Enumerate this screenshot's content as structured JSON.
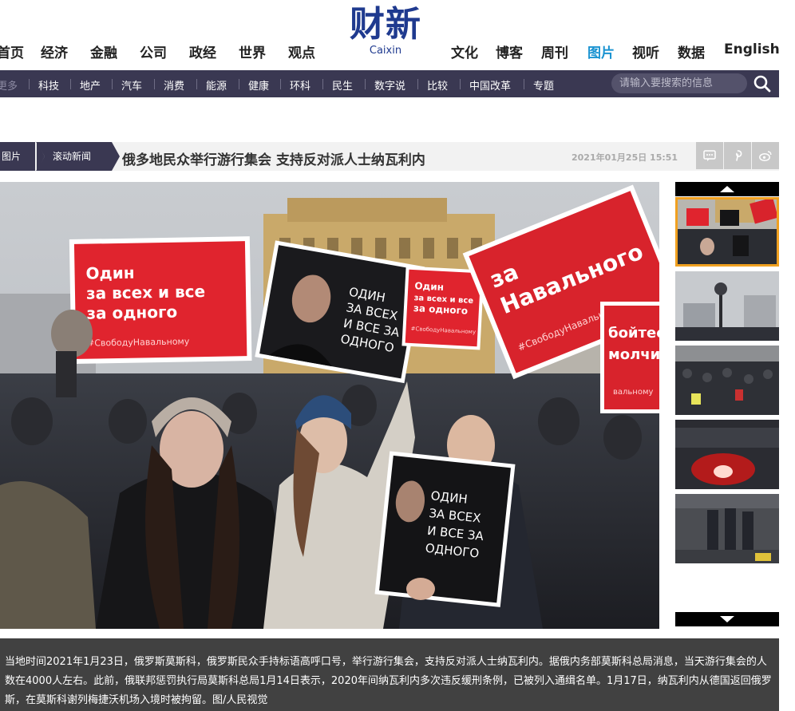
{
  "brand": {
    "name_cn": "财新",
    "name_en": "Caixin",
    "color": "#1f3a8f"
  },
  "top_nav": {
    "left": [
      "首页",
      "经济",
      "金融",
      "公司",
      "政经",
      "世界",
      "观点"
    ],
    "right": [
      "文化",
      "博客",
      "周刊",
      "图片",
      "视听",
      "数据",
      "English"
    ],
    "active": "图片",
    "active_color": "#1a93d1"
  },
  "sub_nav": {
    "items": [
      "更多",
      "科技",
      "地产",
      "汽车",
      "消费",
      "能源",
      "健康",
      "环科",
      "民生",
      "数字说",
      "比较",
      "中国改革",
      "专题"
    ],
    "search_placeholder": "请输入要搜索的信息",
    "bg_color": "#3a3852"
  },
  "breadcrumb": [
    "图片",
    "滚动新闻"
  ],
  "article": {
    "title": "俄多地民众举行游行集会 支持反对派人士纳瓦利内",
    "date": "2021年01月25日 15:51",
    "caption": "当地时间2021年1月23日，俄罗斯莫斯科，俄罗斯民众手持标语高呼口号，举行游行集会，支持反对派人士纳瓦利内。据俄内务部莫斯科总局消息，当天游行集会的人数在4000人左右。此前，俄联邦惩罚执行局莫斯科总局1月14日表示，2020年间纳瓦利内多次违反缓刑条例，已被列入通缉名单。1月17日，纳瓦利内从德国返回俄罗斯，在莫斯科谢列梅捷沃机场入境时被拘留。图/人民视觉"
  },
  "photo_signs": {
    "sign1_line1": "Один",
    "sign1_line2": "за всех и все",
    "sign1_line3": "за одного",
    "sign1_tag": "#СвободуНавальному",
    "sign2": [
      "ОДИН",
      "ЗА ВСЕХ",
      "И ВСЕ ЗА",
      "ОДНОГО"
    ],
    "sign3_line1": "Один",
    "sign3_line2": "за всех и все",
    "sign3_line3": "за одного",
    "sign3_tag": "#СвободуНавальному",
    "sign4_line1": "за",
    "sign4_line2": "Навального",
    "sign4_tag": "#СвободуНавальному",
    "sign5": [
      "ОДИН",
      "ЗА ВСЕХ",
      "И ВСЕ ЗА",
      "ОДНОГО"
    ],
    "sign6_line1": "бойтес",
    "sign6_line2": "молчит",
    "sign6_tag": "вальному"
  },
  "thumbnails": [
    {
      "name": "thumb-1",
      "active": true
    },
    {
      "name": "thumb-2",
      "active": false
    },
    {
      "name": "thumb-3",
      "active": false
    },
    {
      "name": "thumb-4",
      "active": false
    },
    {
      "name": "thumb-5",
      "active": false
    }
  ]
}
